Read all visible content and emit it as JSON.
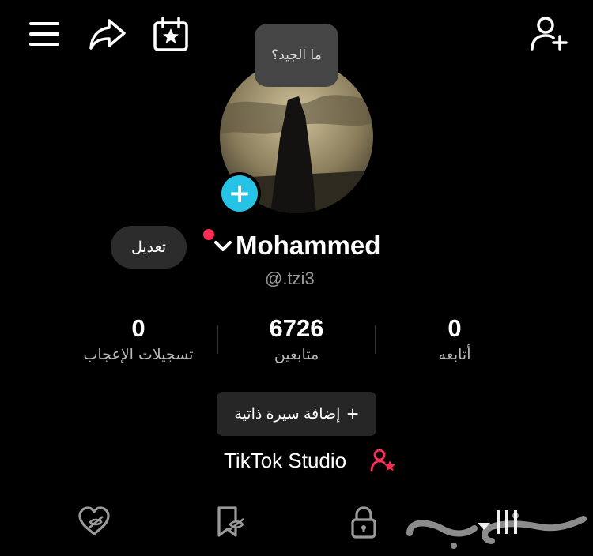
{
  "header": {
    "icons": [
      "menu-icon",
      "share-icon",
      "calendar-star-icon",
      "add-user-icon"
    ]
  },
  "tooltip": {
    "text": "ما الجيد؟"
  },
  "profile": {
    "edit_label": "تعديل",
    "name": "Mohammed",
    "handle": "@.tzi3"
  },
  "stats": [
    {
      "value": "0",
      "label": "تسجيلات الإعجاب"
    },
    {
      "value": "6726",
      "label": "متابعين"
    },
    {
      "value": "0",
      "label": "أتابعه"
    }
  ],
  "bio_button": {
    "label": "إضافة سيرة ذاتية",
    "icon": "plus-icon"
  },
  "studio": {
    "label": "TikTok Studio",
    "icon": "user-star-icon"
  },
  "tabs": [
    "liked-hidden-icon",
    "saved-hidden-icon",
    "lock-icon",
    "videos-grid-icon"
  ],
  "colors": {
    "accent_blue": "#25c3e6",
    "accent_red": "#fe2c55",
    "background": "#000000"
  }
}
